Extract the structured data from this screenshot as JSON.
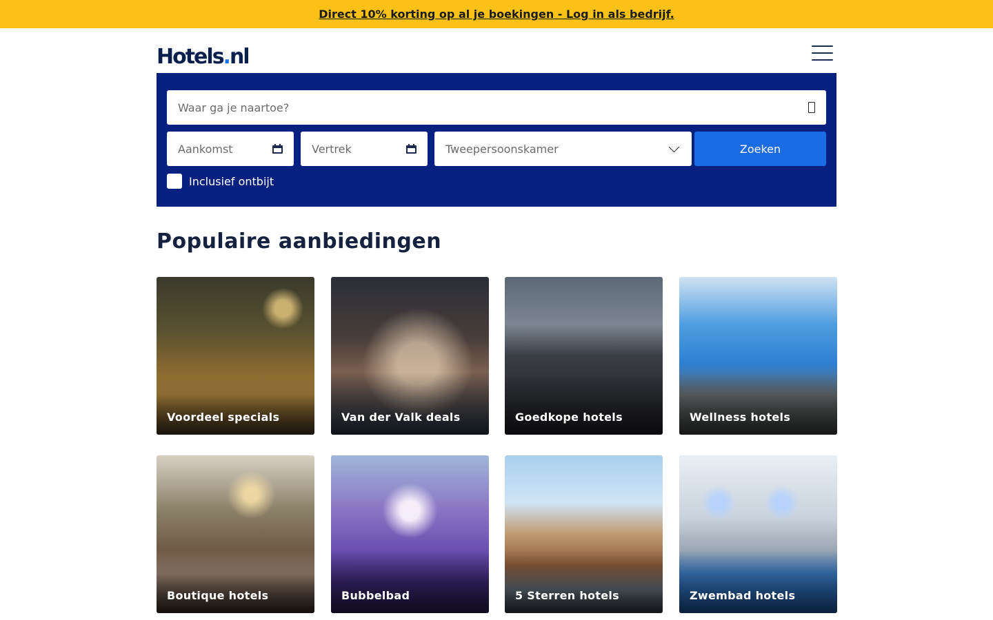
{
  "promo": {
    "text": "Direct 10% korting op al je boekingen - Log in als bedrijf."
  },
  "header": {
    "logo_main": "Hotels",
    "logo_dot": ".",
    "logo_tld": "nl"
  },
  "search": {
    "destination_placeholder": "Waar ga je naartoe?",
    "arrival_placeholder": "Aankomst",
    "departure_placeholder": "Vertrek",
    "room_type": "Tweepersoonskamer",
    "submit_label": "Zoeken",
    "breakfast_label": "Inclusief ontbijt",
    "breakfast_checked": false
  },
  "offers": {
    "title": "Populaire aanbiedingen",
    "cards": [
      {
        "label": "Voordeel specials"
      },
      {
        "label": "Van der Valk deals"
      },
      {
        "label": "Goedkope hotels"
      },
      {
        "label": "Wellness hotels"
      },
      {
        "label": "Boutique hotels"
      },
      {
        "label": "Bubbelbad"
      },
      {
        "label": "5 Sterren hotels"
      },
      {
        "label": "Zwembad hotels"
      }
    ]
  },
  "colors": {
    "promo_bg": "#fbc116",
    "search_panel_bg": "#082080",
    "search_button": "#1a6be6",
    "logo_dot": "#1a73e8",
    "heading": "#14223f"
  }
}
